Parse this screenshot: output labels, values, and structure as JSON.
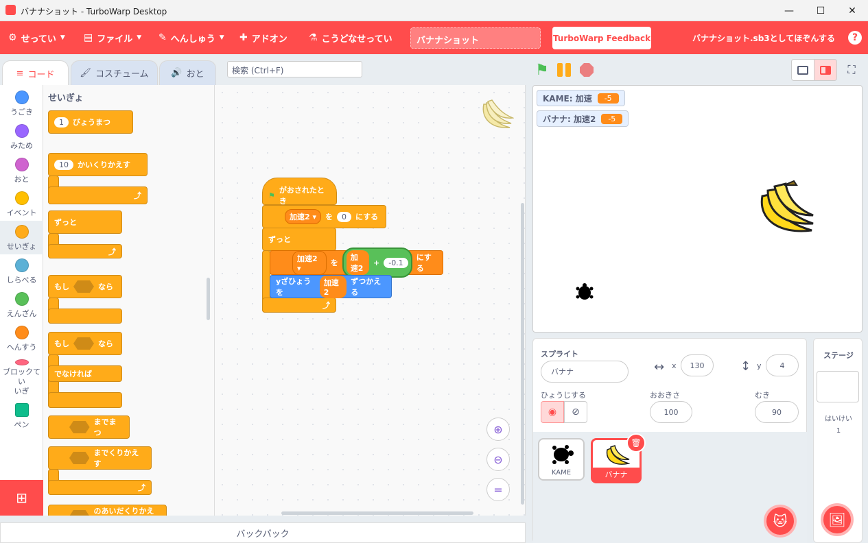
{
  "window": {
    "title": "バナナショット - TurboWarp Desktop",
    "minimize": "—",
    "maximize": "☐",
    "close": "✕"
  },
  "menubar": {
    "settings": "せってい",
    "file": "ファイル",
    "edit": "へんしゅう",
    "addons": "アドオン",
    "custom": "こうどなせってい",
    "project_title": "バナナショット",
    "feedback": "TurboWarp Feedback",
    "save_hint": "バナナショット.sb3としてほぞんする",
    "help": "?"
  },
  "tabs": {
    "code": "コード",
    "costume": "コスチューム",
    "sound": "おと"
  },
  "search": {
    "placeholder": "検索 (Ctrl+F)"
  },
  "categories": [
    {
      "label": "うごき",
      "color": "#4c97ff"
    },
    {
      "label": "みため",
      "color": "#9966ff"
    },
    {
      "label": "おと",
      "color": "#cf63cf"
    },
    {
      "label": "イベント",
      "color": "#ffbf00"
    },
    {
      "label": "せいぎょ",
      "color": "#ffab19"
    },
    {
      "label": "しらべる",
      "color": "#5cb1d6"
    },
    {
      "label": "えんざん",
      "color": "#59c059"
    },
    {
      "label": "へんすう",
      "color": "#ff8c1a"
    },
    {
      "label": "ブロックてい\nいぎ",
      "color": "#ff6680"
    },
    {
      "label": "ペン",
      "color": "#0fbd8c"
    }
  ],
  "palette": {
    "heading": "せいぎょ",
    "wait_num": "1",
    "wait_label": "びょうまつ",
    "repeat_num": "10",
    "repeat_label": "かいくりかえす",
    "forever": "ずっと",
    "if_label": "もし",
    "then_label": "なら",
    "else_label": "でなければ",
    "wait_until": "までまつ",
    "repeat_until": "までくりかえす",
    "cut_off": "のあいだくりかえす"
  },
  "script": {
    "hat": "がおされたとき",
    "set1_var": "加速2 ▾",
    "set1_wo": "を",
    "set1_val": "0",
    "set1_end": "にする",
    "forever": "ずっと",
    "set2_var": "加速2 ▾",
    "set2_wo": "を",
    "set2_reporter": "加速2",
    "set2_plus": "+",
    "set2_val": "-0.1",
    "set2_end": "にする",
    "change_label": "yざひょうを",
    "change_reporter": "加速2",
    "change_end": "ずつかえる"
  },
  "monitors": [
    {
      "label": "KAME: 加速",
      "value": "-5"
    },
    {
      "label": "バナナ: 加速2",
      "value": "-5"
    }
  ],
  "backpack": "バックパック",
  "sprite_info": {
    "sprite_label": "スプライト",
    "sprite_name": "バナナ",
    "x_label": "x",
    "x_value": "130",
    "y_label": "y",
    "y_value": "4",
    "show_label": "ひょうじする",
    "size_label": "おおきさ",
    "size_value": "100",
    "direction_label": "むき",
    "direction_value": "90"
  },
  "sprites": [
    {
      "name": "KAME"
    },
    {
      "name": "バナナ"
    }
  ],
  "stage_pane": {
    "title": "ステージ",
    "backdrops_label": "はいけい",
    "backdrops_count": "1"
  },
  "colors": {
    "accent": "#ff4c4c",
    "control": "#ffab19",
    "variables": "#ff8c1a",
    "motion": "#4c97ff",
    "operators": "#59c059"
  }
}
